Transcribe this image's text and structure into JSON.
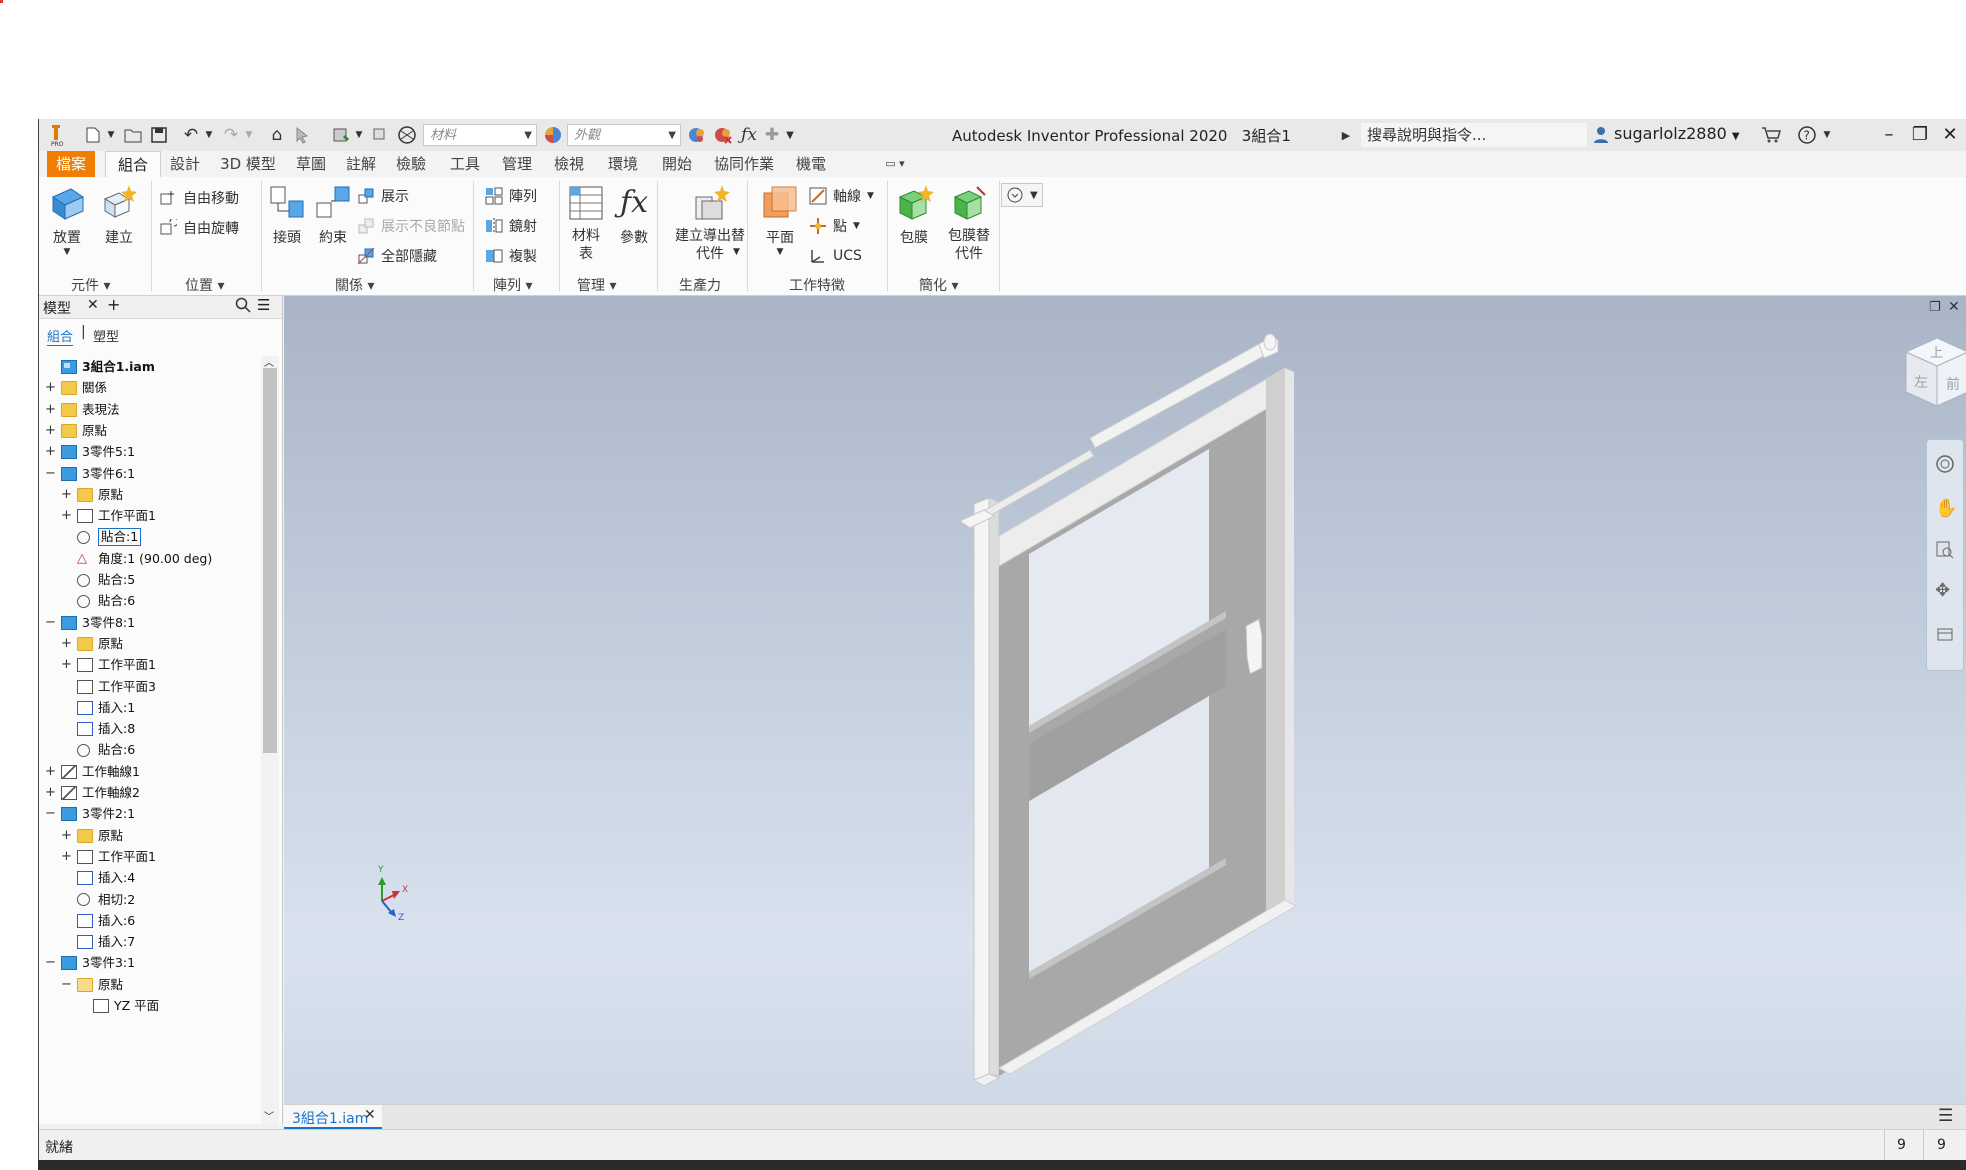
{
  "titlebar": {
    "app_title": "Autodesk Inventor Professional 2020",
    "doc_title": "3組合1",
    "material_placeholder": "材料",
    "appearance_placeholder": "外觀",
    "search_placeholder": "搜尋說明與指令...",
    "username": "sugarlolz2880"
  },
  "tabs": [
    "檔案",
    "組合",
    "設計",
    "3D 模型",
    "草圖",
    "註解",
    "檢驗",
    "工具",
    "管理",
    "檢視",
    "環境",
    "開始",
    "協同作業",
    "機電"
  ],
  "ribbon": {
    "component": {
      "title": "元件",
      "place": "放置",
      "create": "建立"
    },
    "position": {
      "title": "位置",
      "free_move": "自由移動",
      "free_rotate": "自由旋轉"
    },
    "relationships": {
      "title": "關係",
      "joint": "接頭",
      "constrain": "約束",
      "show": "展示",
      "show_sick": "展示不良節點",
      "hide_all": "全部隱藏"
    },
    "pattern": {
      "title": "陣列",
      "pattern": "陣列",
      "mirror": "鏡射",
      "copy": "複製"
    },
    "manage": {
      "title": "管理",
      "bom": "材料表",
      "params": "參數"
    },
    "productivity": {
      "title": "生產力",
      "create_substitute": "建立導出替代件"
    },
    "work_features": {
      "title": "工作特徵",
      "plane": "平面",
      "axis": "軸線",
      "point": "點",
      "ucs": "UCS"
    },
    "simplification": {
      "title": "簡化",
      "shrinkwrap": "包膜",
      "shrinkwrap_sub": "包膜替代件"
    }
  },
  "browser": {
    "title": "模型",
    "tab_assembly": "組合",
    "tab_modeling": "塑型",
    "rows": [
      {
        "label": "3組合1.iam",
        "level": 0,
        "icon": "assembly",
        "exp": "",
        "bold": true
      },
      {
        "label": "關係",
        "level": 0,
        "icon": "folder",
        "exp": "+"
      },
      {
        "label": "表現法",
        "level": 0,
        "icon": "folder",
        "exp": "+"
      },
      {
        "label": "原點",
        "level": 0,
        "icon": "folder",
        "exp": "+"
      },
      {
        "label": "3零件5:1",
        "level": 0,
        "icon": "part",
        "exp": "+"
      },
      {
        "label": "3零件6:1",
        "level": 0,
        "icon": "part",
        "exp": "−"
      },
      {
        "label": "原點",
        "level": 1,
        "icon": "folder",
        "exp": "+"
      },
      {
        "label": "工作平面1",
        "level": 1,
        "icon": "plane",
        "exp": "+"
      },
      {
        "label": "貼合:1",
        "level": 1,
        "icon": "cons",
        "exp": "",
        "selected": true
      },
      {
        "label": "角度:1 (90.00 deg)",
        "level": 1,
        "icon": "angle",
        "exp": ""
      },
      {
        "label": "貼合:5",
        "level": 1,
        "icon": "cons",
        "exp": ""
      },
      {
        "label": "貼合:6",
        "level": 1,
        "icon": "cons",
        "exp": ""
      },
      {
        "label": "3零件8:1",
        "level": 0,
        "icon": "part",
        "exp": "−"
      },
      {
        "label": "原點",
        "level": 1,
        "icon": "folder",
        "exp": "+"
      },
      {
        "label": "工作平面1",
        "level": 1,
        "icon": "plane",
        "exp": "+"
      },
      {
        "label": "工作平面3",
        "level": 1,
        "icon": "plane",
        "exp": ""
      },
      {
        "label": "插入:1",
        "level": 1,
        "icon": "insert",
        "exp": ""
      },
      {
        "label": "插入:8",
        "level": 1,
        "icon": "insert",
        "exp": ""
      },
      {
        "label": "貼合:6",
        "level": 1,
        "icon": "cons",
        "exp": ""
      },
      {
        "label": "工作軸線1",
        "level": 0,
        "icon": "axis",
        "exp": "+"
      },
      {
        "label": "工作軸線2",
        "level": 0,
        "icon": "axis",
        "exp": "+"
      },
      {
        "label": "3零件2:1",
        "level": 0,
        "icon": "part",
        "exp": "−"
      },
      {
        "label": "原點",
        "level": 1,
        "icon": "folder",
        "exp": "+"
      },
      {
        "label": "工作平面1",
        "level": 1,
        "icon": "plane",
        "exp": "+"
      },
      {
        "label": "插入:4",
        "level": 1,
        "icon": "insert",
        "exp": ""
      },
      {
        "label": "相切:2",
        "level": 1,
        "icon": "tangent",
        "exp": ""
      },
      {
        "label": "插入:6",
        "level": 1,
        "icon": "insert",
        "exp": ""
      },
      {
        "label": "插入:7",
        "level": 1,
        "icon": "insert",
        "exp": ""
      },
      {
        "label": "3零件3:1",
        "level": 0,
        "icon": "part",
        "exp": "−"
      },
      {
        "label": "原點",
        "level": 1,
        "icon": "folder-open",
        "exp": "−"
      },
      {
        "label": "YZ 平面",
        "level": 2,
        "icon": "plane",
        "exp": ""
      }
    ]
  },
  "viewcube": {
    "top": "上",
    "front": "前",
    "left": "左"
  },
  "triad": {
    "x": "X",
    "y": "Y",
    "z": "Z"
  },
  "document_tab": "3組合1.iam",
  "status": {
    "text": "就緒",
    "num1": "9",
    "num2": "9"
  }
}
